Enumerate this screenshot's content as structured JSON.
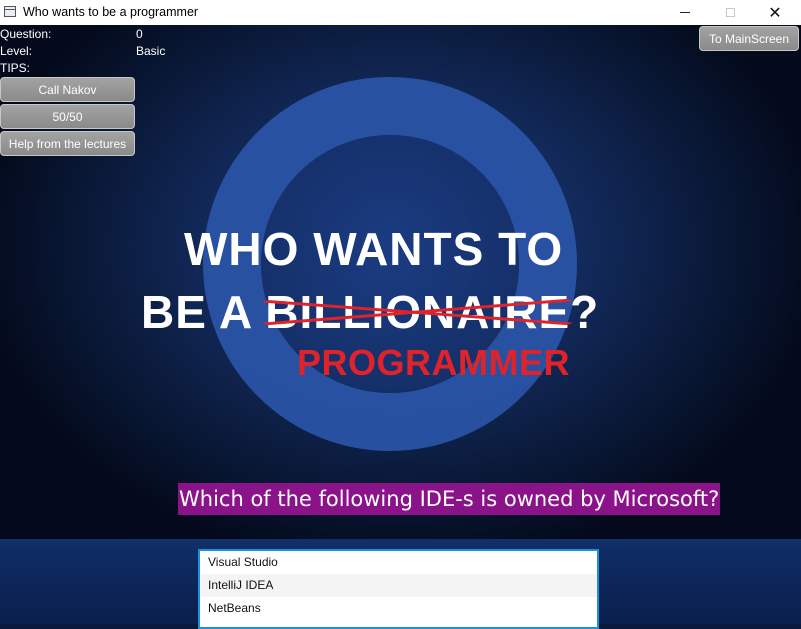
{
  "window": {
    "title": "Who wants to be a programmer",
    "minimize_glyph": "—",
    "close_glyph": "✕"
  },
  "logo": {
    "line1": "WHO WANTS TO",
    "line2_prefix": "BE A ",
    "struck_word": "BILLIONAIRE",
    "line2_suffix": "?",
    "replacement": "PROGRAMMER"
  },
  "info": {
    "question_label": "Question:",
    "question_value": "0",
    "level_label": "Level:",
    "level_value": "Basic",
    "tips_label": "TIPS:"
  },
  "tips": {
    "call": "Call Nakov",
    "fifty": "50/50",
    "lectures": "Help from the lectures"
  },
  "nav": {
    "main_screen": "To MainScreen"
  },
  "question": {
    "text": "Which of the following IDE-s is owned by Microsoft?"
  },
  "answers": [
    "Visual Studio",
    "IntelliJ IDEA",
    "NetBeans"
  ],
  "colors": {
    "question_bg": "#8a138a",
    "logo_red": "#e0232b",
    "ring_blue": "#2a55a8",
    "list_border": "#1e8fd8"
  }
}
